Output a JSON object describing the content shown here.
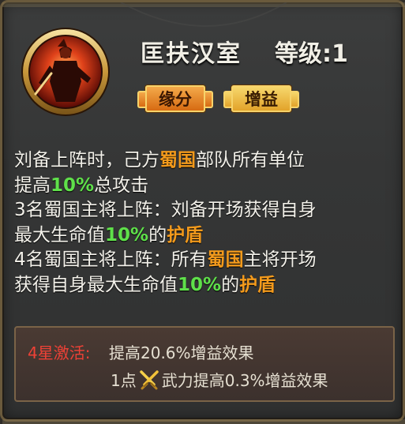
{
  "header": {
    "title": "匡扶汉室",
    "level": "等级:1"
  },
  "tags": {
    "yuanfen": "缘分",
    "zengyi": "增益"
  },
  "description": {
    "l1a": "刘备上阵时，己方",
    "l1b": "蜀国",
    "l1c": "部队所有单位",
    "l2a": "提高",
    "l2b": "10%",
    "l2c": "总攻击",
    "l3": "3名蜀国主将上阵：刘备开场获得自身",
    "l4a": "最大生命值",
    "l4b": "10%",
    "l4c": "的",
    "l4d": "护盾",
    "l5a": "4名蜀国主将上阵：所有",
    "l5b": "蜀国",
    "l5c": "主将开场",
    "l6a": "获得自身最大生命值",
    "l6b": "10%",
    "l6c": "的",
    "l6d": "护盾"
  },
  "star_activation": {
    "label": "4星激活:",
    "effect": "提高20.6%增益效果",
    "per_point_prefix": "1点",
    "per_point_icon": "crossed-swords-icon",
    "per_point_suffix": "武力提高0.3%增益效果"
  },
  "colors": {
    "highlight_orange": "#f39a1c",
    "highlight_green": "#5fe04a",
    "star_label_red": "#ee4136",
    "panel_bg": "#353636"
  }
}
